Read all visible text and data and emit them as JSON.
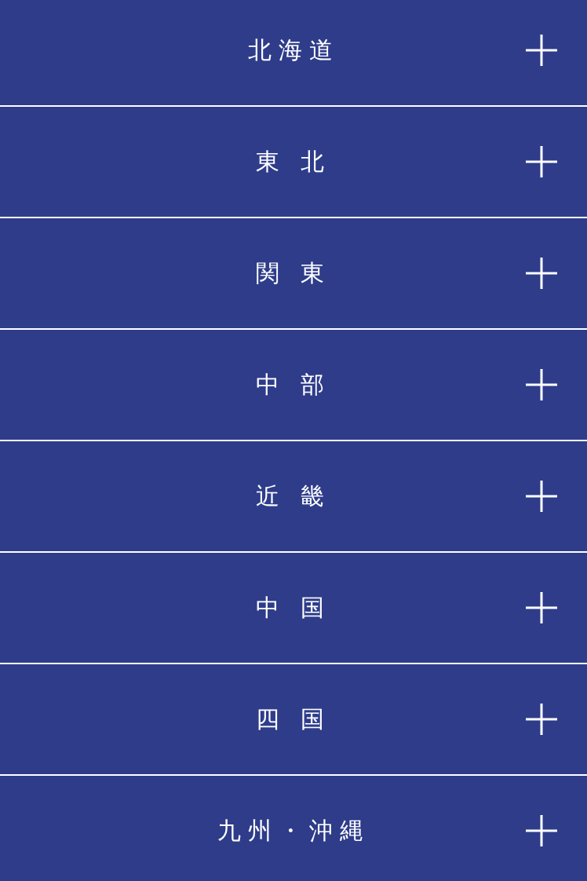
{
  "regions": [
    {
      "label": "北海道",
      "expanded": false
    },
    {
      "label": "東 北",
      "expanded": false
    },
    {
      "label": "関 東",
      "expanded": false
    },
    {
      "label": "中 部",
      "expanded": false
    },
    {
      "label": "近 畿",
      "expanded": false
    },
    {
      "label": "中 国",
      "expanded": false
    },
    {
      "label": "四 国",
      "expanded": false
    },
    {
      "label": "九州・沖縄",
      "expanded": false
    }
  ]
}
